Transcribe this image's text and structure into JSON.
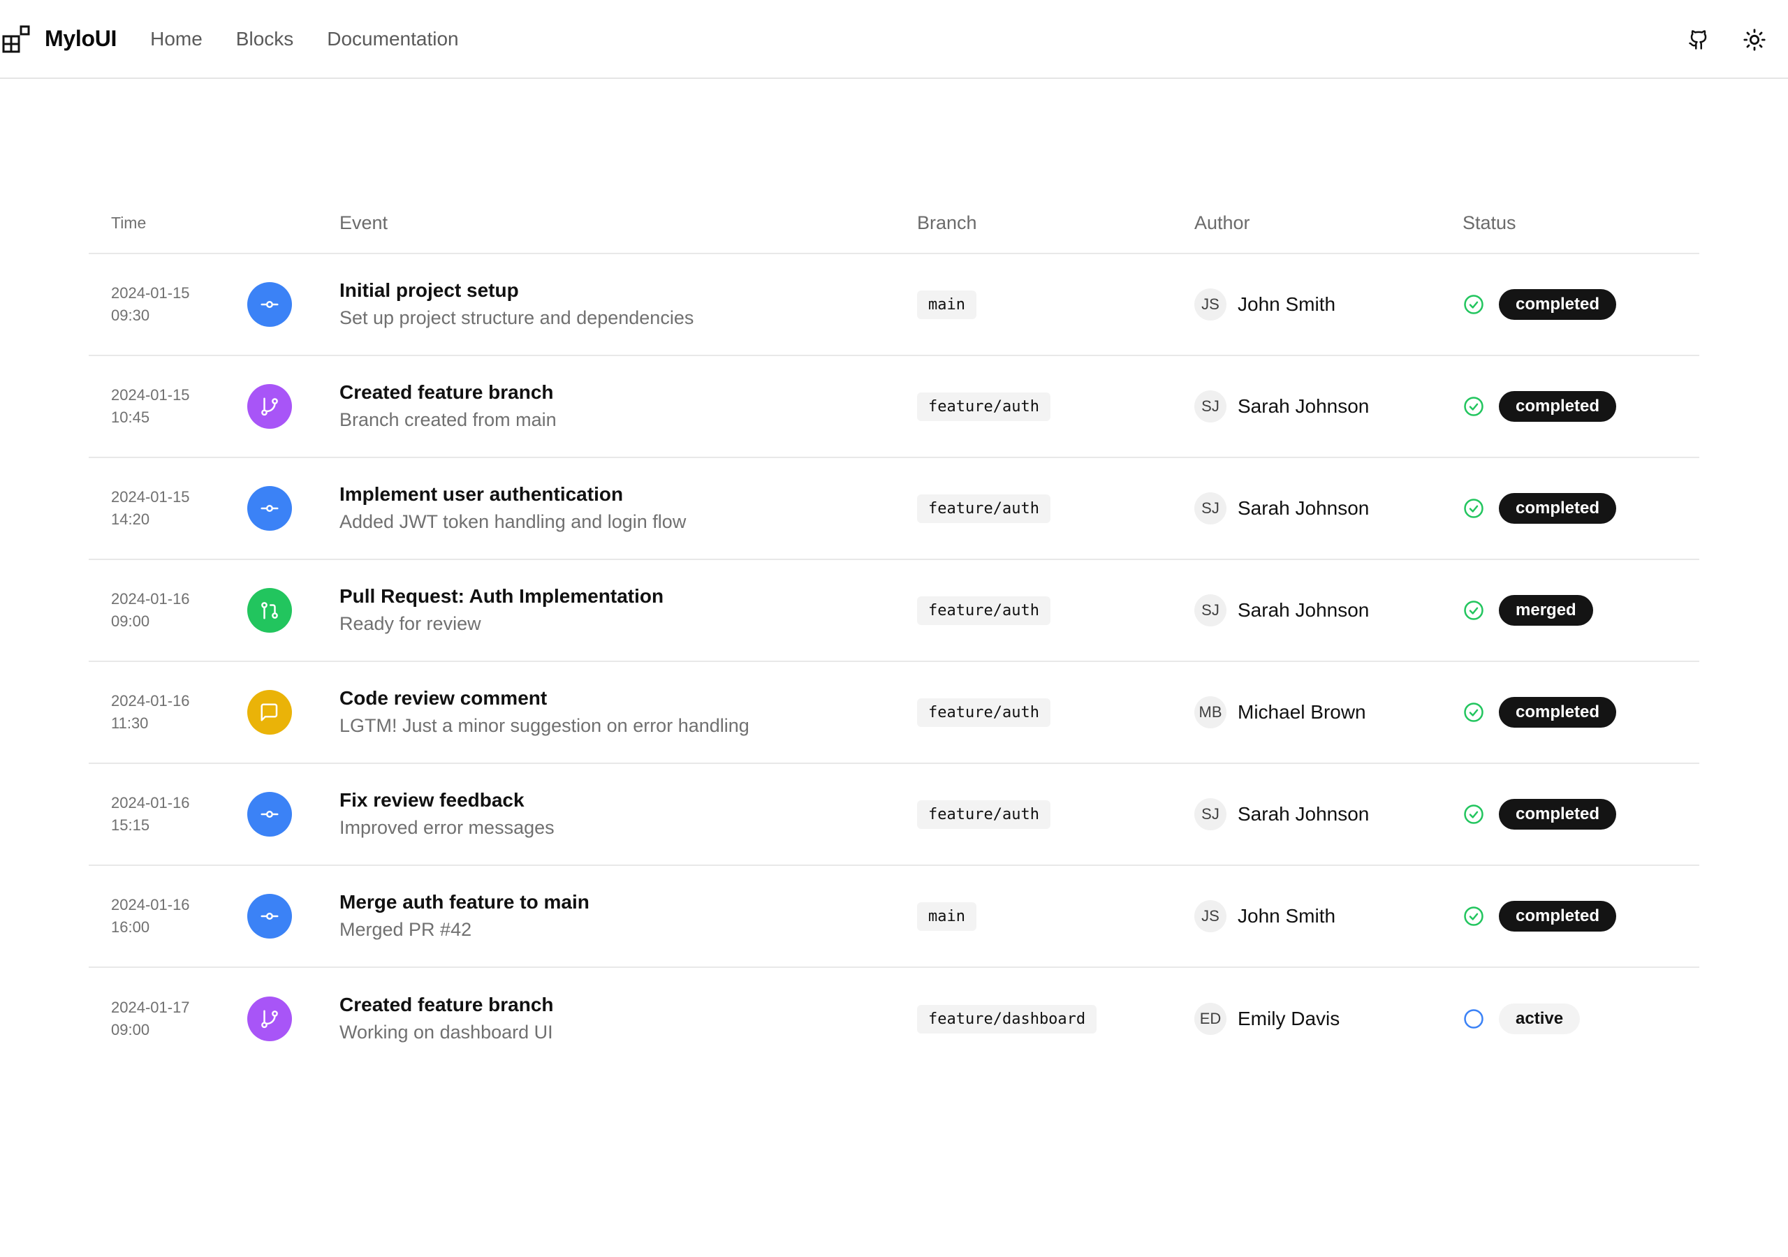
{
  "app": {
    "name": "MyloUI",
    "nav": [
      "Home",
      "Blocks",
      "Documentation"
    ]
  },
  "table": {
    "headers": {
      "time": "Time",
      "event": "Event",
      "branch": "Branch",
      "author": "Author",
      "status": "Status"
    },
    "rows": [
      {
        "date": "2024-01-15",
        "time": "09:30",
        "icon": "commit-icon",
        "color": "#3b82f6",
        "title": "Initial project setup",
        "desc": "Set up project structure and dependencies",
        "branch": "main",
        "initials": "JS",
        "author": "John Smith",
        "status": "completed"
      },
      {
        "date": "2024-01-15",
        "time": "10:45",
        "icon": "branch-icon",
        "color": "#a855f7",
        "title": "Created feature branch",
        "desc": "Branch created from main",
        "branch": "feature/auth",
        "initials": "SJ",
        "author": "Sarah Johnson",
        "status": "completed"
      },
      {
        "date": "2024-01-15",
        "time": "14:20",
        "icon": "commit-icon",
        "color": "#3b82f6",
        "title": "Implement user authentication",
        "desc": "Added JWT token handling and login flow",
        "branch": "feature/auth",
        "initials": "SJ",
        "author": "Sarah Johnson",
        "status": "completed"
      },
      {
        "date": "2024-01-16",
        "time": "09:00",
        "icon": "pull-request-icon",
        "color": "#22c55e",
        "title": "Pull Request: Auth Implementation",
        "desc": "Ready for review",
        "branch": "feature/auth",
        "initials": "SJ",
        "author": "Sarah Johnson",
        "status": "merged"
      },
      {
        "date": "2024-01-16",
        "time": "11:30",
        "icon": "comment-icon",
        "color": "#eab308",
        "title": "Code review comment",
        "desc": "LGTM! Just a minor suggestion on error handling",
        "branch": "feature/auth",
        "initials": "MB",
        "author": "Michael Brown",
        "status": "completed"
      },
      {
        "date": "2024-01-16",
        "time": "15:15",
        "icon": "commit-icon",
        "color": "#3b82f6",
        "title": "Fix review feedback",
        "desc": "Improved error messages",
        "branch": "feature/auth",
        "initials": "SJ",
        "author": "Sarah Johnson",
        "status": "completed"
      },
      {
        "date": "2024-01-16",
        "time": "16:00",
        "icon": "commit-icon",
        "color": "#3b82f6",
        "title": "Merge auth feature to main",
        "desc": "Merged PR #42",
        "branch": "main",
        "initials": "JS",
        "author": "John Smith",
        "status": "completed"
      },
      {
        "date": "2024-01-17",
        "time": "09:00",
        "icon": "branch-icon",
        "color": "#a855f7",
        "title": "Created feature branch",
        "desc": "Working on dashboard UI",
        "branch": "feature/dashboard",
        "initials": "ED",
        "author": "Emily Davis",
        "status": "active"
      }
    ]
  },
  "colors": {
    "status_done": "#22c55e",
    "status_active": "#3b82f6"
  }
}
